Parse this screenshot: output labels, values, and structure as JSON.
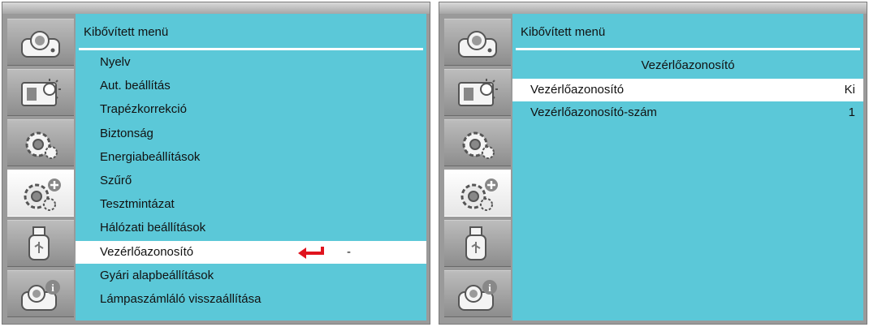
{
  "left": {
    "title": "Kibővített menü",
    "items": [
      {
        "label": "Nyelv"
      },
      {
        "label": "Aut. beállítás"
      },
      {
        "label": "Trapézkorrekció"
      },
      {
        "label": "Biztonság"
      },
      {
        "label": "Energiabeállítások"
      },
      {
        "label": "Szűrő"
      },
      {
        "label": "Tesztmintázat"
      },
      {
        "label": "Hálózati beállítások"
      },
      {
        "label": "Vezérlőazonosító",
        "value": "-"
      },
      {
        "label": "Gyári alapbeállítások"
      },
      {
        "label": "Lámpaszámláló visszaállítása"
      }
    ],
    "selected_index": 8
  },
  "right": {
    "title": "Kibővített menü",
    "subtitle": "Vezérlőazonosító",
    "rows": [
      {
        "label": "Vezérlőazonosító",
        "value": "Ki"
      },
      {
        "label": "Vezérlőazonosító-szám",
        "value": "1"
      }
    ],
    "selected_index": 0
  },
  "sidebar_icons": [
    "image-menu-icon",
    "display-settings-icon",
    "settings-gear-icon",
    "extended-settings-icon",
    "usb-icon",
    "info-icon"
  ],
  "active_sidebar_index": 3,
  "colors": {
    "content_bg": "#5bc8d8",
    "enter_arrow": "#e0141e"
  }
}
